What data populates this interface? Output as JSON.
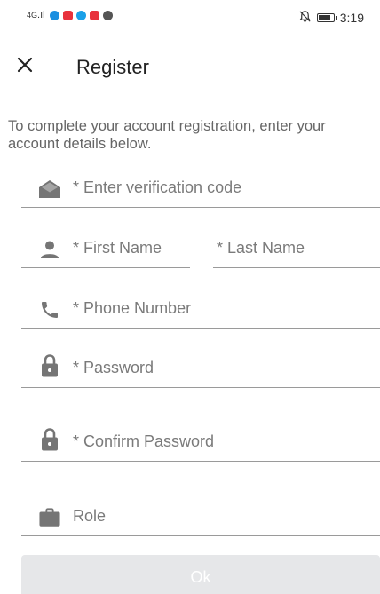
{
  "status_bar": {
    "network": "4G",
    "time": "3:19",
    "battery_level": 0.85,
    "app_icon_colors": [
      "#1b8fe0",
      "#e8323c",
      "#1aa0e8",
      "#e8323c",
      "#555555"
    ]
  },
  "header": {
    "title": "Register",
    "close_icon": "close-icon"
  },
  "instructions": "To complete your account registration, enter your account details below.",
  "fields": {
    "verification_code": {
      "placeholder": "* Enter verification code",
      "icon": "envelope-open-icon"
    },
    "first_name": {
      "placeholder": "* First Name",
      "icon": "person-icon"
    },
    "last_name": {
      "placeholder": "* Last Name"
    },
    "phone_number": {
      "placeholder": "* Phone Number",
      "icon": "phone-icon"
    },
    "password": {
      "placeholder": "* Password",
      "icon": "lock-icon"
    },
    "confirm_password": {
      "placeholder": "* Confirm Password",
      "icon": "lock-icon"
    },
    "role": {
      "placeholder": "Role",
      "icon": "briefcase-icon"
    }
  },
  "ok_button": {
    "label": "Ok",
    "background": "#e6e7e9",
    "text_color": "#ffffff"
  },
  "icon_color": "#757575"
}
